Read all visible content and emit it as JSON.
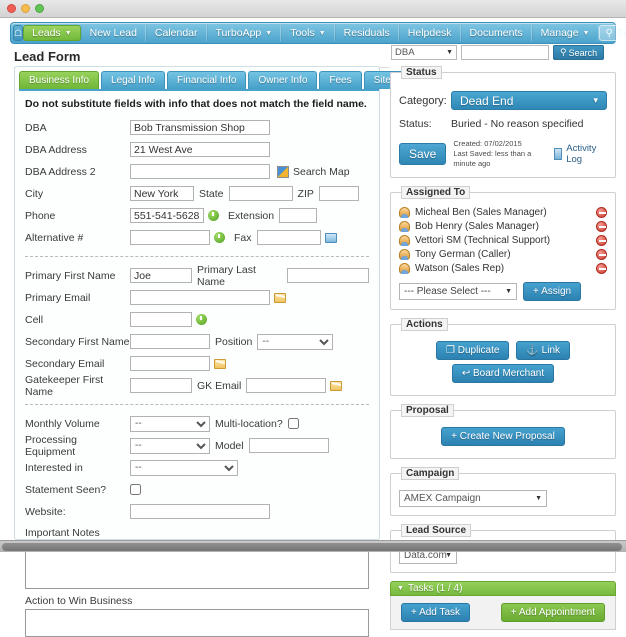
{
  "window": {
    "traffic_lights": [
      "close-red",
      "minimize-yellow",
      "zoom-green"
    ]
  },
  "navbar": {
    "home_icon": "home-icon",
    "items": [
      {
        "label": "Leads",
        "has_caret": true,
        "active": true
      },
      {
        "label": "New Lead",
        "has_caret": false,
        "active": false
      },
      {
        "label": "Calendar",
        "has_caret": false,
        "active": false
      },
      {
        "label": "TurboApp",
        "has_caret": true,
        "active": false
      },
      {
        "label": "Tools",
        "has_caret": true,
        "active": false
      },
      {
        "label": "Residuals",
        "has_caret": false,
        "active": false
      },
      {
        "label": "Helpdesk",
        "has_caret": false,
        "active": false
      },
      {
        "label": "Documents",
        "has_caret": false,
        "active": false
      },
      {
        "label": "Manage",
        "has_caret": true,
        "active": false
      }
    ],
    "search": {
      "placeholder": "Search",
      "value": "",
      "icon": "search-icon"
    }
  },
  "page": {
    "title": "Lead Form"
  },
  "top_search": {
    "field_selector": "DBA",
    "query_value": "",
    "button_label": "Search"
  },
  "tabs": [
    {
      "label": "Business Info",
      "active": true
    },
    {
      "label": "Legal Info",
      "active": false
    },
    {
      "label": "Financial Info",
      "active": false
    },
    {
      "label": "Owner Info",
      "active": false
    },
    {
      "label": "Fees",
      "active": false
    },
    {
      "label": "Site Survey",
      "active": false
    }
  ],
  "form": {
    "warning": "Do not substitute fields with info that does not match the field name.",
    "dba_label": "DBA",
    "dba_value": "Bob Transmission Shop",
    "dba_address_label": "DBA Address",
    "dba_address_value": "21 West Ave",
    "dba_address2_label": "DBA Address 2",
    "dba_address2_value": "",
    "search_map_label": "Search Map",
    "city_label": "City",
    "city_value": "New York",
    "state_label": "State",
    "state_value": "",
    "zip_label": "ZIP",
    "zip_value": "",
    "phone_label": "Phone",
    "phone_value": "551-541-5628",
    "extension_label": "Extension",
    "extension_value": "",
    "alternative_label": "Alternative #",
    "alternative_value": "",
    "fax_label": "Fax",
    "fax_value": "",
    "primary_first_label": "Primary First Name",
    "primary_first_value": "Joe",
    "primary_last_label": "Primary Last Name",
    "primary_last_value": "",
    "primary_email_label": "Primary Email",
    "primary_email_value": "",
    "cell_label": "Cell",
    "cell_value": "",
    "secondary_first_label": "Secondary First Name",
    "secondary_first_value": "",
    "position_label": "Position",
    "position_value": "--",
    "secondary_email_label": "Secondary Email",
    "secondary_email_value": "",
    "gatekeeper_label": "Gatekeeper First Name",
    "gatekeeper_value": "",
    "gk_email_label": "GK Email",
    "gk_email_value": "",
    "monthly_volume_label": "Monthly Volume",
    "monthly_volume_value": "--",
    "multi_location_label": "Multi-location?",
    "multi_location_checked": false,
    "processing_equipment_label": "Processing Equipment",
    "processing_equipment_value": "--",
    "model_label": "Model",
    "model_value": "",
    "interested_in_label": "Interested in",
    "interested_in_value": "--",
    "statement_seen_label": "Statement Seen?",
    "statement_seen_checked": false,
    "website_label": "Website:",
    "website_value": "",
    "important_notes_label": "Important Notes",
    "important_notes_value": "",
    "action_to_win_label": "Action to Win Business",
    "action_to_win_value": ""
  },
  "status_panel": {
    "legend": "Status",
    "category_label": "Category:",
    "category_value": "Dead End",
    "status_label": "Status:",
    "status_value": "Buried - No reason specified",
    "save_label": "Save",
    "created_line": "Created: 07/02/2015",
    "last_saved_line": "Last Saved: less than a minute ago",
    "activity_log_label": "Activity Log"
  },
  "assigned_panel": {
    "legend": "Assigned To",
    "users": [
      "Micheal Ben (Sales Manager)",
      "Bob Henry (Sales Manager)",
      "Vettori SM (Technical Support)",
      "Tony German (Caller)",
      "Watson (Sales Rep)"
    ],
    "select_value": "--- Please Select ---",
    "assign_button": "+ Assign"
  },
  "actions_panel": {
    "legend": "Actions",
    "duplicate_label": "Duplicate",
    "link_label": "Link",
    "board_merchant_label": "Board Merchant"
  },
  "proposal_panel": {
    "legend": "Proposal",
    "create_label": "Create New Proposal"
  },
  "campaign_panel": {
    "legend": "Campaign",
    "value": "AMEX Campaign"
  },
  "lead_source_panel": {
    "legend": "Lead Source",
    "value": "Data.com"
  },
  "tasks_panel": {
    "header": "Tasks (1 / 4)",
    "add_task_label": "+ Add Task",
    "add_appointment_label": "+ Add Appointment"
  },
  "colors": {
    "nav_blue": "#4ba3cc",
    "accent_green": "#76b93c",
    "button_blue": "#2c81b1",
    "delete_red": "#cc3a2c"
  }
}
